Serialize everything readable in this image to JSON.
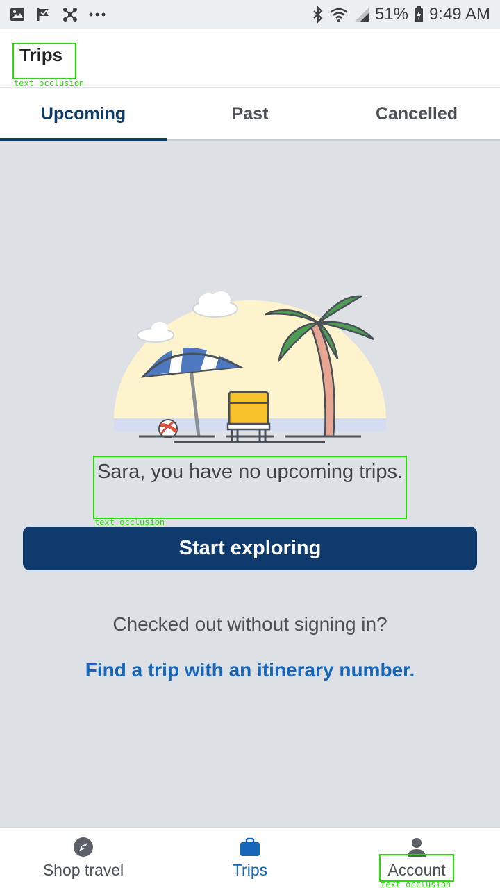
{
  "status_bar": {
    "battery": "51%",
    "time": "9:49 AM"
  },
  "app_bar": {
    "title": "Trips"
  },
  "tabs": [
    {
      "label": "Upcoming",
      "active": true
    },
    {
      "label": "Past",
      "active": false
    },
    {
      "label": "Cancelled",
      "active": false
    }
  ],
  "empty_state": {
    "message": "Sara, you have no upcoming trips.",
    "cta_label": "Start exploring",
    "checked_out_text": "Checked out without signing in?",
    "find_trip_link": "Find a trip with an itinerary number."
  },
  "bottom_nav": [
    {
      "label": "Shop travel",
      "icon": "compass-icon",
      "active": false
    },
    {
      "label": "Trips",
      "icon": "briefcase-icon",
      "active": true
    },
    {
      "label": "Account",
      "icon": "person-icon",
      "active": false
    }
  ],
  "annotations": {
    "occlusion_label": "text occlusion"
  },
  "colors": {
    "primary": "#0f3a6d",
    "link": "#1565b8",
    "background": "#dde1e6"
  }
}
